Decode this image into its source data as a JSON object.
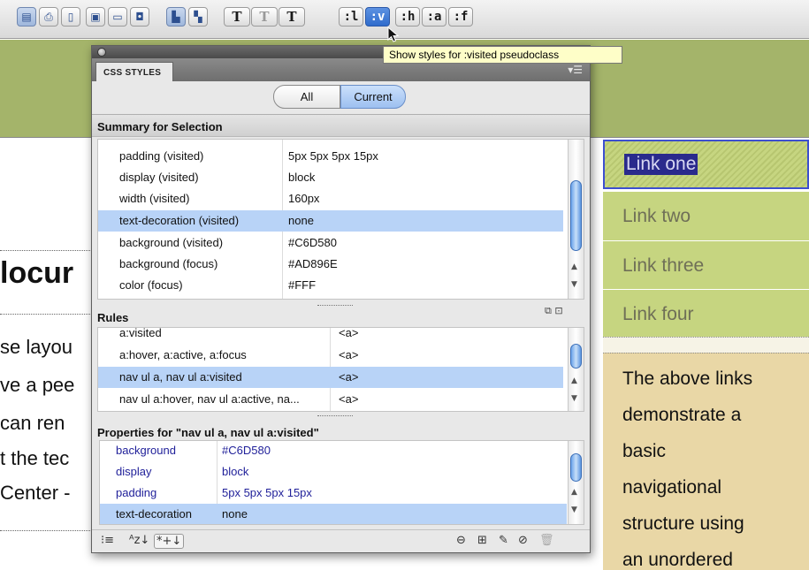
{
  "toolbar": {
    "icon_buttons": [
      "layout-table-icon",
      "print-icon",
      "file-icon",
      "render-icon",
      "display-icon",
      "media-icon",
      "style-rendering-icon",
      "split-icon"
    ],
    "text_buttons": [
      "T",
      "T",
      "T"
    ],
    "pseudo_buttons": [
      ":l",
      ":v",
      ":h",
      ":a",
      ":f"
    ],
    "active_pseudo": ":v"
  },
  "tooltip": {
    "text": "Show styles for :visited pseudoclass"
  },
  "panel": {
    "tab_label": "CSS STYLES",
    "segment_all": "All",
    "segment_current": "Current",
    "summary_title": "Summary for Selection",
    "summary_rows": [
      {
        "name": "padding (visited)",
        "value": "5px 5px 5px 15px"
      },
      {
        "name": "display (visited)",
        "value": "block"
      },
      {
        "name": "width (visited)",
        "value": "160px"
      },
      {
        "name": "text-decoration (visited)",
        "value": "none"
      },
      {
        "name": "background (visited)",
        "value": "#C6D580"
      },
      {
        "name": "background (focus)",
        "value": "#AD896E"
      },
      {
        "name": "color (focus)",
        "value": "#FFF"
      }
    ],
    "rules_title": "Rules",
    "rules_rows": [
      {
        "selector": "a:visited",
        "tag": "<a>"
      },
      {
        "selector": "a:hover, a:active, a:focus",
        "tag": "<a>"
      },
      {
        "selector": "nav ul a, nav ul a:visited",
        "tag": "<a>"
      },
      {
        "selector": "nav ul a:hover, nav ul a:active, na...",
        "tag": "<a>"
      }
    ],
    "props_title": "Properties for \"nav ul a, nav ul a:visited\"",
    "props_rows": [
      {
        "name": "background",
        "value": "#C6D580"
      },
      {
        "name": "display",
        "value": "block"
      },
      {
        "name": "padding",
        "value": "5px 5px 5px 15px"
      },
      {
        "name": "text-decoration",
        "value": "none"
      }
    ]
  },
  "document": {
    "heading_fragment": "locur",
    "text_fragments": [
      "se layou",
      "ve a pee",
      " can ren",
      "t the tec",
      "Center -"
    ],
    "nav_links": [
      "Link one",
      "Link two",
      "Link three",
      "Link four"
    ],
    "nav_paragraph": [
      "The above links",
      "demonstrate a",
      "basic",
      "navigational",
      "structure using",
      "an unordered"
    ]
  },
  "colors": {
    "header_green": "#a4b46a",
    "link_bg": "#C6D580",
    "selection_blue": "#b8d3f7",
    "sidebar_tan": "#e9d7a6"
  }
}
